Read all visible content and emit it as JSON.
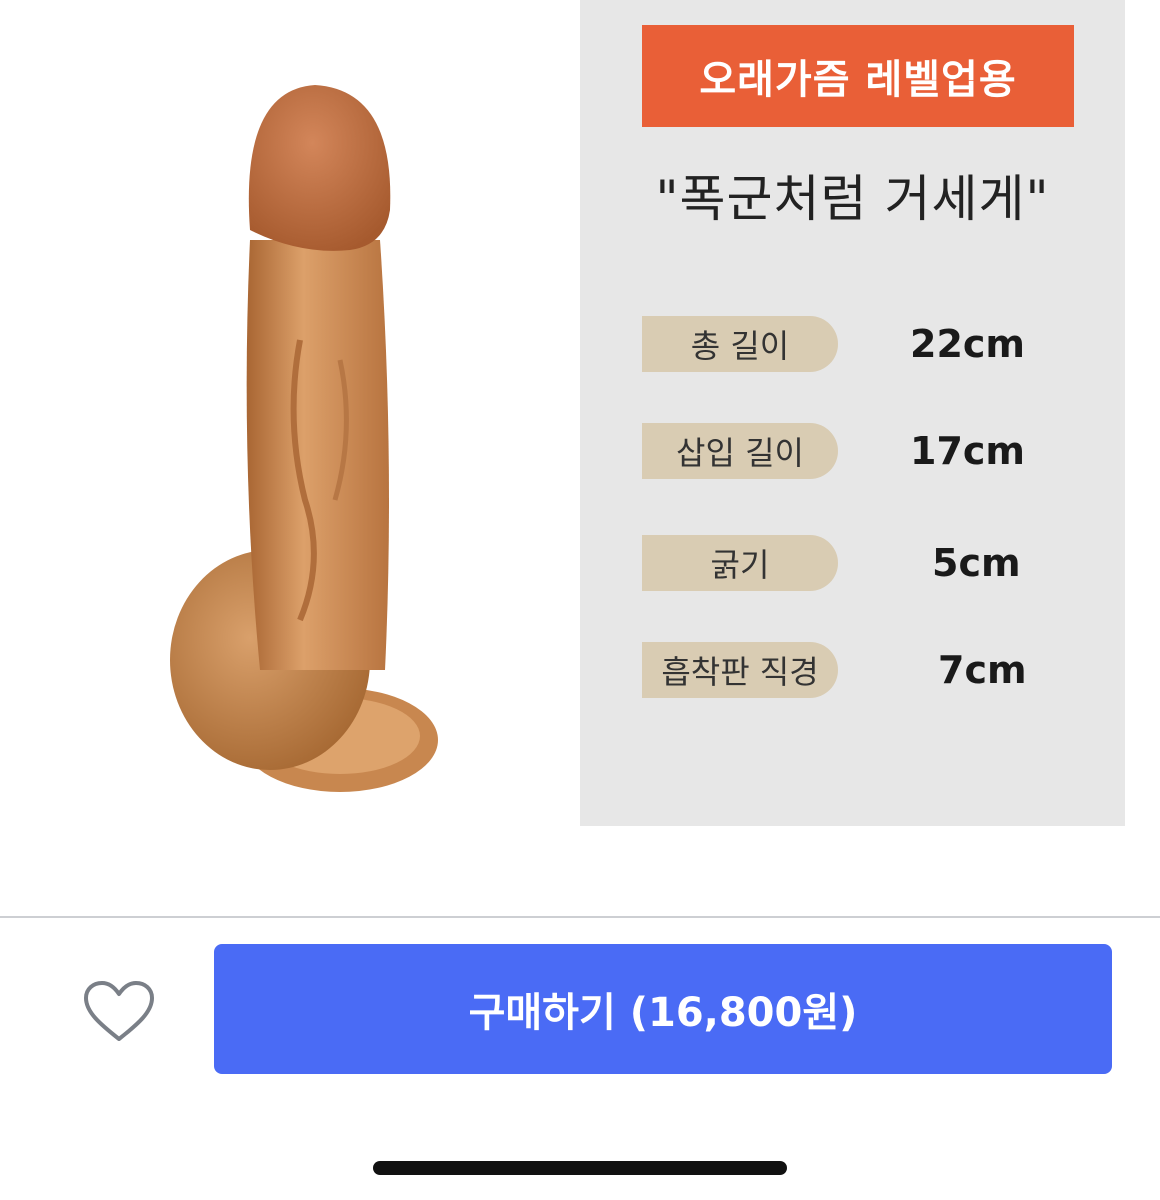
{
  "promo": {
    "banner_text": "오래가즘 레벨업용",
    "headline": "\"폭군처럼 거세게\""
  },
  "specs": [
    {
      "label": "총 길이",
      "value": "22cm"
    },
    {
      "label": "삽입 길이",
      "value": "17cm"
    },
    {
      "label": "굵기",
      "value": "5cm"
    },
    {
      "label": "흡착판 직경",
      "value": "7cm"
    }
  ],
  "footer": {
    "buy_label": "구매하기 (16,800원)",
    "favorite_icon": "heart-icon"
  },
  "colors": {
    "banner": "#e95f37",
    "spec_panel": "#e7e7e7",
    "spec_label_bg": "#d9ccb3",
    "buy_button": "#4a6bf5",
    "product": "#c8874f"
  }
}
